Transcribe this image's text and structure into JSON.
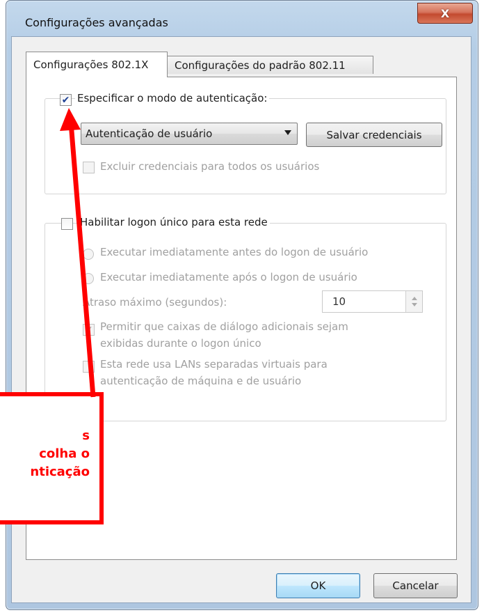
{
  "window": {
    "title": "Configurações avançadas",
    "close_glyph": "X"
  },
  "tabs": [
    {
      "label": "Configurações 802.1X",
      "active": true
    },
    {
      "label": "Configurações do padrão 802.11",
      "active": false
    }
  ],
  "auth_group": {
    "specify_mode_label": "Especificar o modo de autenticação:",
    "specify_mode_checked": true,
    "auth_mode_selected": "Autenticação de usuário",
    "save_credentials_label": "Salvar credenciais",
    "delete_credentials_label": "Excluir credenciais para todos os usuários",
    "delete_credentials_checked": false
  },
  "sso_group": {
    "enable_sso_label": "Habilitar logon único para esta rede",
    "enable_sso_checked": false,
    "radio_before_label": "Executar imediatamente antes do logon de usuário",
    "radio_after_label": "Executar imediatamente após o logon de usuário",
    "max_delay_label": "Atraso máximo (segundos):",
    "max_delay_value": "10",
    "allow_dialogs_label_line1": "Permitir que caixas de diálogo adicionais sejam",
    "allow_dialogs_label_line2": "exibidas durante o logon único",
    "allow_dialogs_checked": true,
    "vlan_label_line1": "Esta rede usa LANs separadas virtuais para",
    "vlan_label_line2": "autenticação de máquina e de usuário",
    "vlan_checked": false
  },
  "footer": {
    "ok_label": "OK",
    "cancel_label": "Cancelar"
  },
  "annotation": {
    "line1": "s",
    "line2": "colha o",
    "line3": "nticação",
    "color": "#ff0000"
  },
  "colors": {
    "frame": "#b4cde6",
    "close_button": "#c34a2f",
    "check_blue": "#1c3f94",
    "disabled_text": "#a0a0a0"
  }
}
